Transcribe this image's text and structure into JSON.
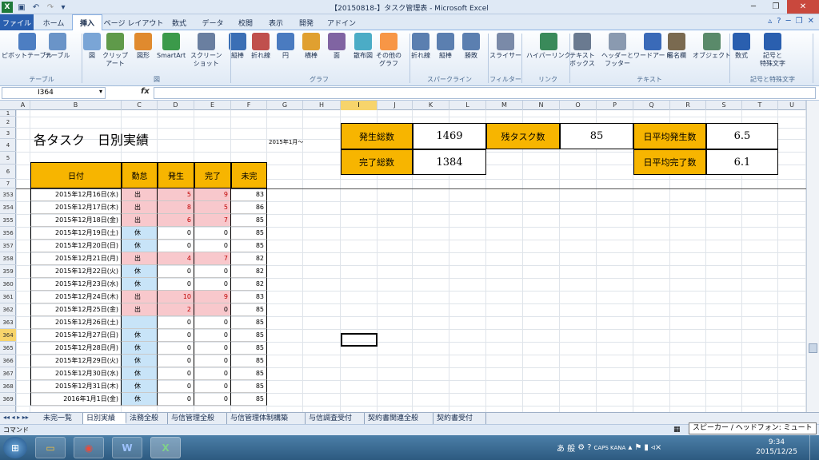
{
  "window": {
    "title": "【20150818-】タスク管理表 - Microsoft Excel"
  },
  "tabs": [
    "ファイル",
    "ホーム",
    "挿入",
    "ページ レイアウト",
    "数式",
    "データ",
    "校閲",
    "表示",
    "開発",
    "アドイン"
  ],
  "ribbon": {
    "buttons": [
      {
        "label": "ピボットテーブル",
        "sub": "",
        "icon": "pivot-table-icon",
        "color": "#4d7ec2"
      },
      {
        "label": "テーブル",
        "sub": "",
        "icon": "table-icon",
        "color": "#6a94c8"
      },
      {
        "label": "図",
        "sub": "",
        "icon": "picture-icon",
        "color": "#7aa5d6"
      },
      {
        "label": "クリップ",
        "sub": "アート",
        "icon": "clip-art-icon",
        "color": "#5f9a4a"
      },
      {
        "label": "図形",
        "sub": "",
        "icon": "shapes-icon",
        "color": "#e08a2e"
      },
      {
        "label": "SmartArt",
        "sub": "",
        "icon": "smartart-icon",
        "color": "#3b9a4a"
      },
      {
        "label": "スクリーン",
        "sub": "ショット",
        "icon": "screenshot-icon",
        "color": "#6a7fa0"
      },
      {
        "label": "縦棒",
        "sub": "",
        "icon": "column-chart-icon",
        "color": "#3b6fb5"
      },
      {
        "label": "折れ線",
        "sub": "",
        "icon": "line-chart-icon",
        "color": "#c0504d"
      },
      {
        "label": "円",
        "sub": "",
        "icon": "pie-chart-icon",
        "color": "#4a7bc0"
      },
      {
        "label": "横棒",
        "sub": "",
        "icon": "bar-chart-icon",
        "color": "#e0a030"
      },
      {
        "label": "面",
        "sub": "",
        "icon": "area-chart-icon",
        "color": "#8064a2"
      },
      {
        "label": "散布図",
        "sub": "",
        "icon": "scatter-chart-icon",
        "color": "#4bacc6"
      },
      {
        "label": "その他の",
        "sub": "グラフ",
        "icon": "other-charts-icon",
        "color": "#f79646"
      },
      {
        "label": "折れ線",
        "sub": "",
        "icon": "sparkline-line-icon",
        "color": "#5b7fb0"
      },
      {
        "label": "縦棒",
        "sub": "",
        "icon": "sparkline-column-icon",
        "color": "#5b7fb0"
      },
      {
        "label": "勝敗",
        "sub": "",
        "icon": "sparkline-winloss-icon",
        "color": "#5b7fb0"
      },
      {
        "label": "スライサー",
        "sub": "",
        "icon": "slicer-icon",
        "color": "#7a8aa8"
      },
      {
        "label": "ハイパーリンク",
        "sub": "",
        "icon": "hyperlink-icon",
        "color": "#3a8a5a"
      },
      {
        "label": "テキスト",
        "sub": "ボックス",
        "icon": "textbox-icon",
        "color": "#6a7a90"
      },
      {
        "label": "ヘッダーと",
        "sub": "フッター",
        "icon": "header-footer-icon",
        "color": "#8a9ab0"
      },
      {
        "label": "ワードアート",
        "sub": "",
        "icon": "wordart-icon",
        "color": "#3a6ab8"
      },
      {
        "label": "署名欄",
        "sub": "",
        "icon": "signature-line-icon",
        "color": "#7a6a50"
      },
      {
        "label": "オブジェクト",
        "sub": "",
        "icon": "object-icon",
        "color": "#5a8a6a"
      },
      {
        "label": "数式",
        "sub": "",
        "icon": "equation-icon",
        "color": "#2a5faf"
      },
      {
        "label": "記号と",
        "sub": "特殊文字",
        "icon": "symbol-icon",
        "color": "#2a5faf"
      }
    ],
    "groups": [
      "テーブル",
      "図",
      "グラフ",
      "スパークライン",
      "フィルター",
      "リンク",
      "テキスト",
      "記号と特殊文字"
    ]
  },
  "formula_bar": {
    "name_box": "I364",
    "fx": "fx",
    "value": ""
  },
  "columns": [
    "A",
    "B",
    "C",
    "D",
    "E",
    "F",
    "G",
    "H",
    "I",
    "J",
    "K",
    "L",
    "M",
    "N",
    "O",
    "P",
    "Q",
    "R",
    "S",
    "T",
    "U"
  ],
  "selected_column": "I",
  "rows": [
    "1",
    "2",
    "3",
    "4",
    "5",
    "6",
    "7",
    "353",
    "354",
    "355",
    "356",
    "357",
    "358",
    "359",
    "360",
    "361",
    "362",
    "363",
    "364",
    "365",
    "366",
    "367",
    "368",
    "369"
  ],
  "selected_row": "364",
  "sheet": {
    "title": "各タスク　日別実績",
    "subtitle": "2015年1月～",
    "headers": [
      "日付",
      "勤怠",
      "発生",
      "完了",
      "未完"
    ],
    "records": [
      {
        "date": "2015年12月16日(水)",
        "att": "出",
        "occ": "5",
        "done": "9",
        "open": "83",
        "type": "work"
      },
      {
        "date": "2015年12月17日(木)",
        "att": "出",
        "occ": "8",
        "done": "5",
        "open": "86",
        "type": "work"
      },
      {
        "date": "2015年12月18日(金)",
        "att": "出",
        "occ": "6",
        "done": "7",
        "open": "85",
        "type": "work"
      },
      {
        "date": "2015年12月19日(土)",
        "att": "休",
        "occ": "0",
        "done": "0",
        "open": "85",
        "type": "off"
      },
      {
        "date": "2015年12月20日(日)",
        "att": "休",
        "occ": "0",
        "done": "0",
        "open": "85",
        "type": "off"
      },
      {
        "date": "2015年12月21日(月)",
        "att": "出",
        "occ": "4",
        "done": "7",
        "open": "82",
        "type": "work"
      },
      {
        "date": "2015年12月22日(火)",
        "att": "休",
        "occ": "0",
        "done": "0",
        "open": "82",
        "type": "off"
      },
      {
        "date": "2015年12月23日(水)",
        "att": "休",
        "occ": "0",
        "done": "0",
        "open": "82",
        "type": "off"
      },
      {
        "date": "2015年12月24日(木)",
        "att": "出",
        "occ": "10",
        "done": "9",
        "open": "83",
        "type": "work"
      },
      {
        "date": "2015年12月25日(金)",
        "att": "出",
        "occ": "2",
        "done": "0",
        "open": "85",
        "type": "work"
      },
      {
        "date": "2015年12月26日(土)",
        "att": "",
        "occ": "0",
        "done": "0",
        "open": "85",
        "type": "off"
      },
      {
        "date": "2015年12月27日(日)",
        "att": "休",
        "occ": "0",
        "done": "0",
        "open": "85",
        "type": "off"
      },
      {
        "date": "2015年12月28日(月)",
        "att": "休",
        "occ": "0",
        "done": "0",
        "open": "85",
        "type": "off"
      },
      {
        "date": "2015年12月29日(火)",
        "att": "休",
        "occ": "0",
        "done": "0",
        "open": "85",
        "type": "off"
      },
      {
        "date": "2015年12月30日(水)",
        "att": "休",
        "occ": "0",
        "done": "0",
        "open": "85",
        "type": "off"
      },
      {
        "date": "2015年12月31日(木)",
        "att": "休",
        "occ": "0",
        "done": "0",
        "open": "85",
        "type": "off"
      },
      {
        "date": "2016年1月1日(金)",
        "att": "休",
        "occ": "0",
        "done": "0",
        "open": "85",
        "type": "off"
      }
    ],
    "kpis": {
      "total_occurred_label": "発生総数",
      "total_occurred": "1469",
      "remaining_label": "残タスク数",
      "remaining": "85",
      "daily_occurred_label": "日平均発生数",
      "daily_occurred": "6.5",
      "total_done_label": "完了総数",
      "total_done": "1384",
      "daily_done_label": "日平均完了数",
      "daily_done": "6.1"
    }
  },
  "sheet_tabs": [
    "未完一覧",
    "日別実績",
    "法務全般",
    "与信管理全般",
    "与信管理体制構築",
    "与信調査受付",
    "契約書関連全般",
    "契約書受付"
  ],
  "active_sheet": "日別実績",
  "status": {
    "mode": "コマンド",
    "tooltip": "スピーカー / ヘッドフォン: ミュート"
  },
  "taskbar": {
    "time": "9:34",
    "date": "2015/12/25",
    "ime": "あ 般"
  },
  "colors": {
    "header": "#f7b500",
    "work": "#f8c8cc",
    "off": "#c8e4f8",
    "accent": "#2a5faf"
  }
}
